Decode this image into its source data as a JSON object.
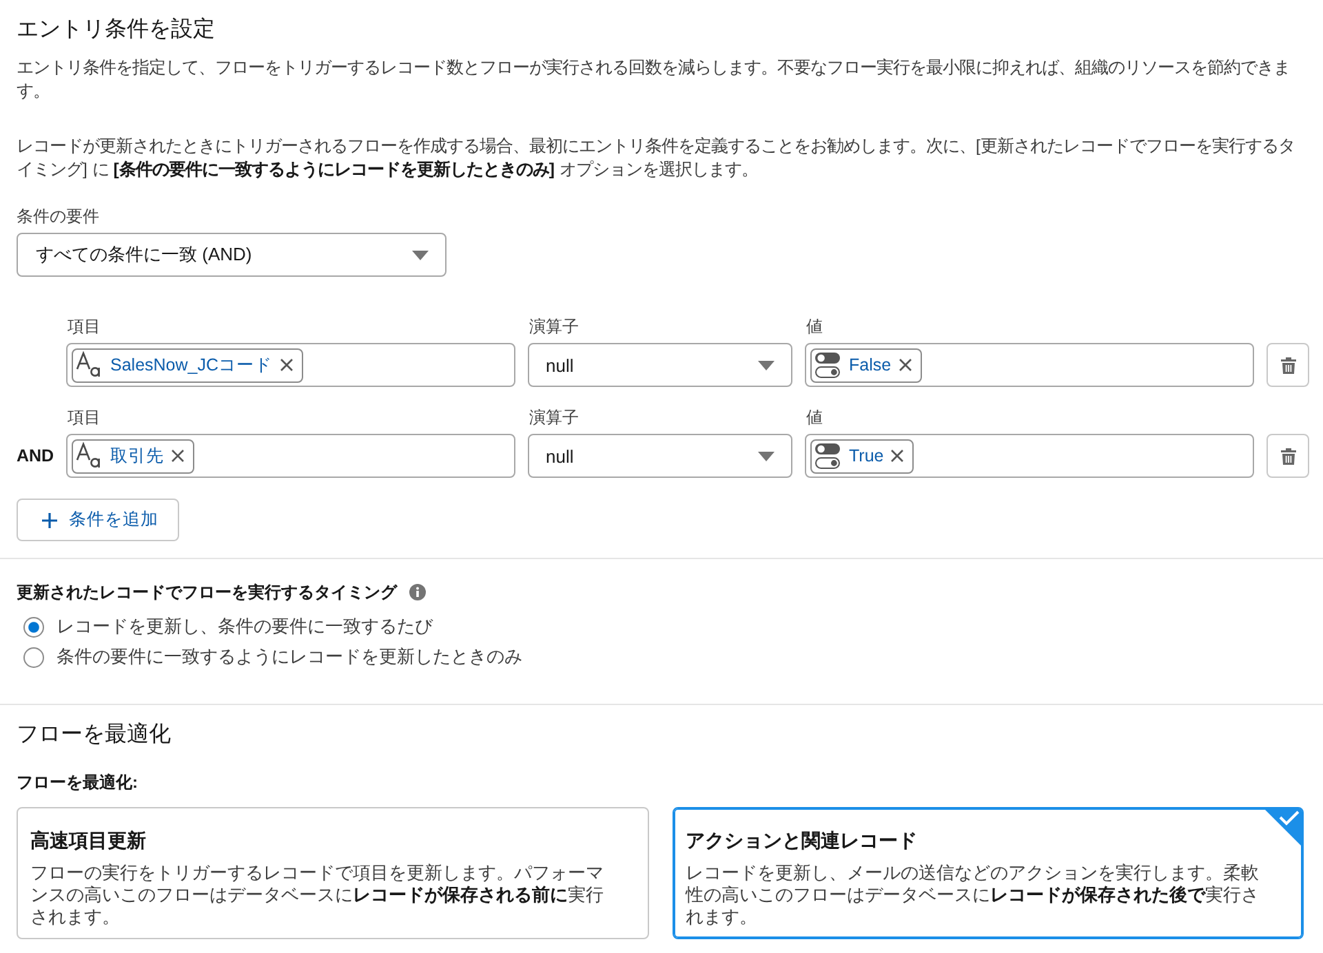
{
  "entry_conditions": {
    "title": "エントリ条件を設定",
    "paragraphs": [
      "エントリ条件を指定して、フローをトリガーするレコード数とフローが実行される回数を減らします。不要なフロー実行を最小限に抑えれば、組織のリソースを節約できます。",
      "レコードが更新されたときにトリガーされるフローを作成する場合、最初にエントリ条件を定義することをお勧めします。次に、[更新されたレコードでフローを実行するタイミング] に **[条件の要件に一致するようにレコードを更新したときのみ]** オプションを選択します。"
    ],
    "requirement": {
      "label": "条件の要件",
      "value": "すべての条件に一致 (AND)"
    },
    "conditions": [
      {
        "field_label": "項目",
        "field": {
          "kind": "text",
          "value": "SalesNow_JCコード"
        },
        "operator_label": "演算子",
        "operator": "null",
        "value_label": "値",
        "value": {
          "kind": "boolean",
          "value": "False"
        }
      },
      {
        "logic": "AND",
        "field_label": "項目",
        "field": {
          "kind": "text",
          "value": "取引先"
        },
        "operator_label": "演算子",
        "operator": "null",
        "value_label": "値",
        "value": {
          "kind": "boolean",
          "value": "True"
        }
      }
    ],
    "add_button": "条件を追加"
  },
  "run_timing": {
    "label": "更新されたレコードでフローを実行するタイミング",
    "options": [
      {
        "label": "レコードを更新し、条件の要件に一致するたび",
        "selected": true
      },
      {
        "label": "条件の要件に一致するようにレコードを更新したときのみ",
        "selected": false
      }
    ]
  },
  "optimize": {
    "title": "フローを最適化",
    "label": "フローを最適化:",
    "options": [
      {
        "title": "高速項目更新",
        "description": "フローの実行をトリガーするレコードで項目を更新します。パフォーマンスの高いこのフローはデータベースに**レコードが保存される前に**実行されます。",
        "selected": false
      },
      {
        "title": "アクションと関連レコード",
        "description": "レコードを更新し、メールの送信などのアクションを実行します。柔軟性の高いこのフローはデータベースに**レコードが保存された後で**実行されます。",
        "selected": true
      }
    ]
  }
}
